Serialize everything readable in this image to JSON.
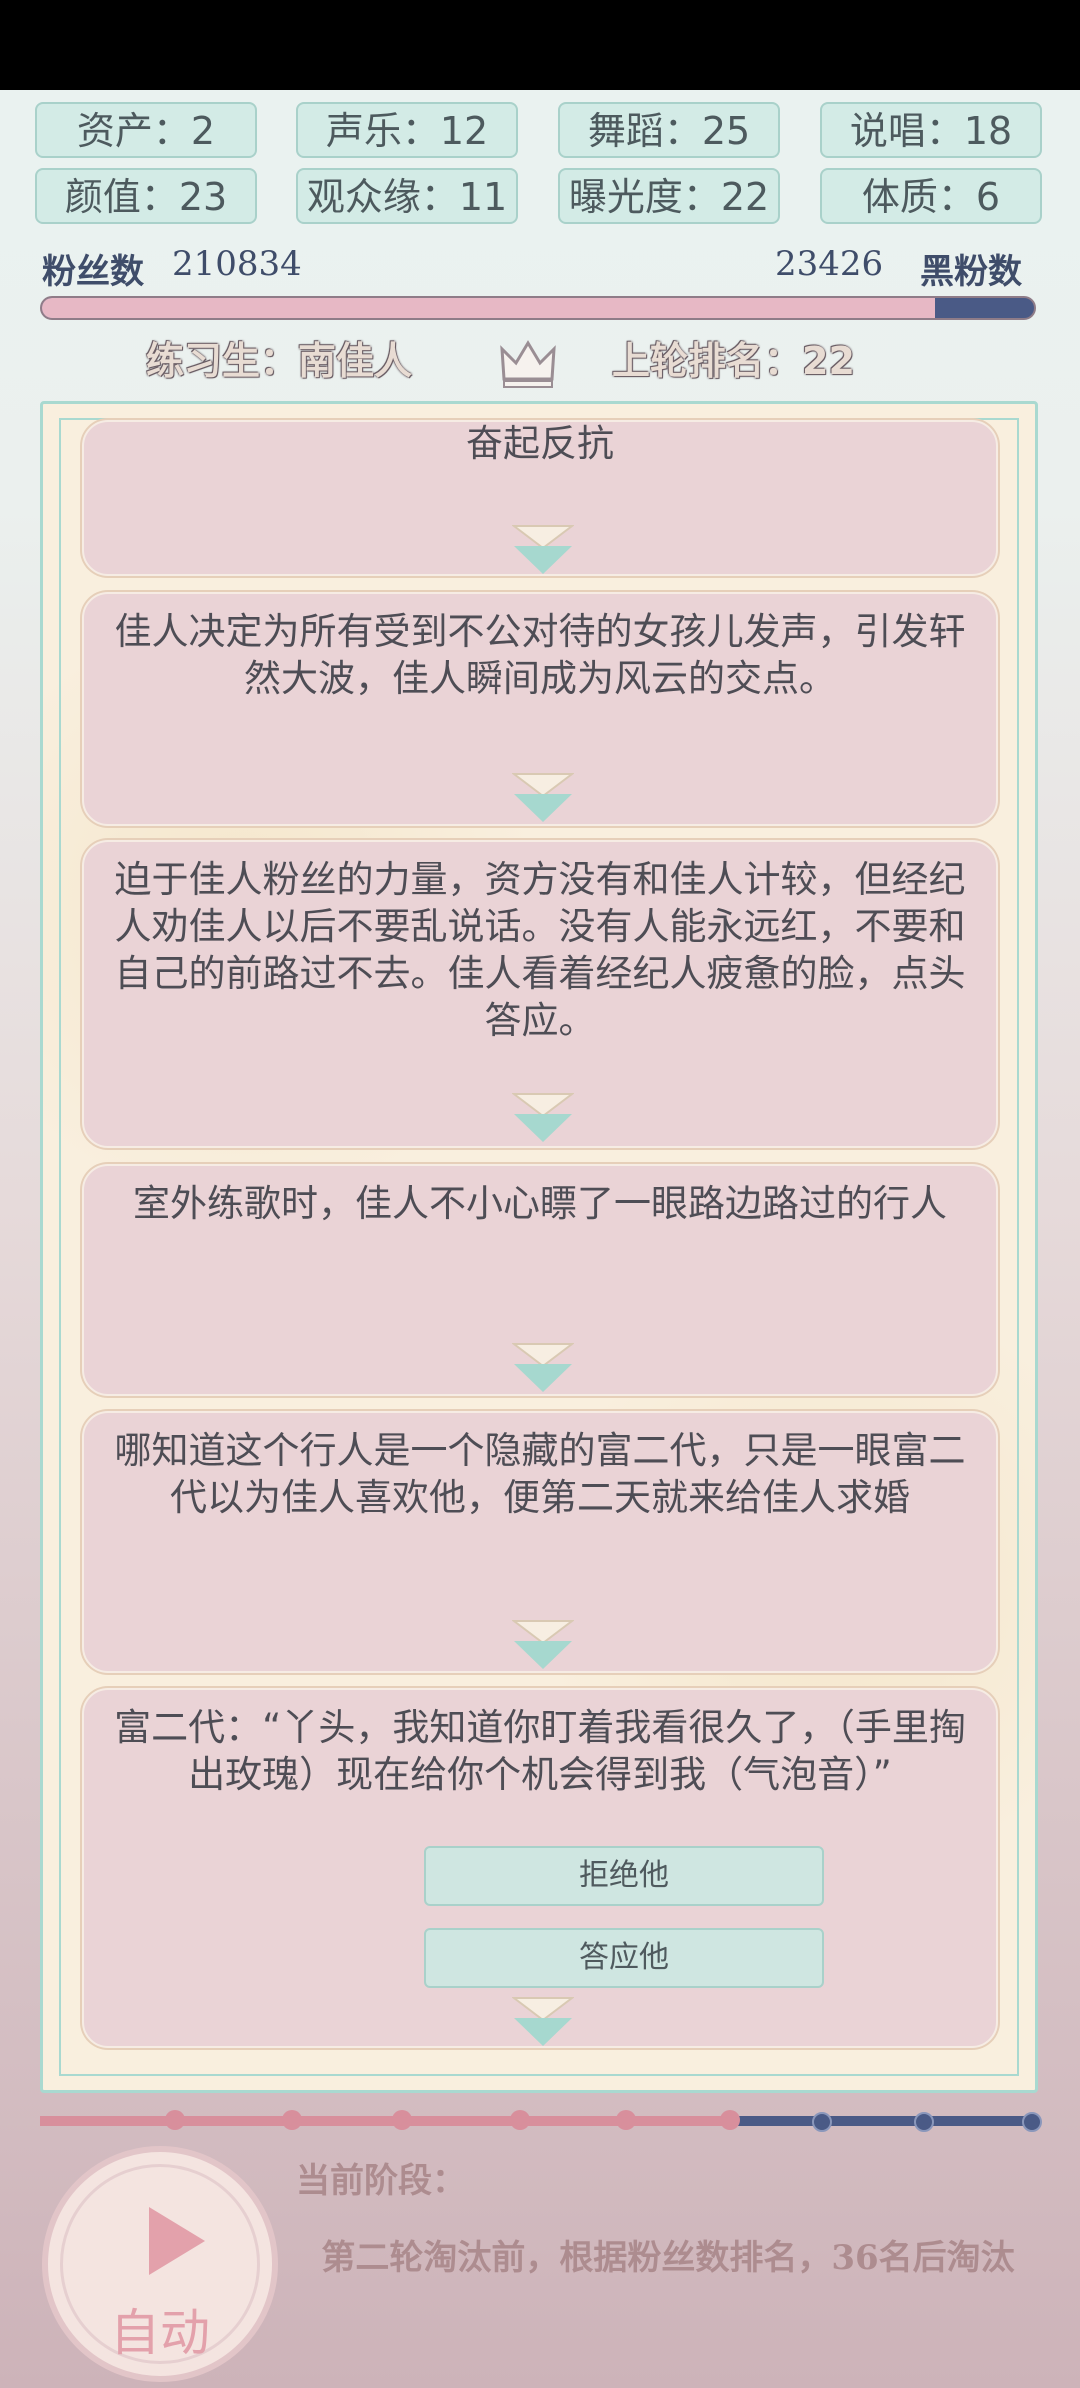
{
  "stats": {
    "assets": "资产：2",
    "vocal": "声乐：12",
    "dance": "舞蹈：25",
    "rap": "说唱：18",
    "looks": "颜值：23",
    "audience": "观众缘：11",
    "exposure": "曝光度：22",
    "physique": "体质：6"
  },
  "fans": {
    "label": "粉丝数",
    "count": "210834",
    "anti_count": "23426",
    "anti_label": "黑粉数",
    "fan_fraction": 0.9
  },
  "trainee": {
    "name_line": "练习生：南佳人",
    "rank_line": "上轮排名：22"
  },
  "story": {
    "cards": [
      "奋起反抗",
      "佳人决定为所有受到不公对待的女孩儿发声，引发轩然大波，佳人瞬间成为风云的交点。",
      "迫于佳人粉丝的力量，资方没有和佳人计较，但经纪人劝佳人以后不要乱说话。没有人能永远红，不要和自己的前路过不去。佳人看着经纪人疲惫的脸，点头答应。",
      "室外练歌时，佳人不小心瞟了一眼路边路过的行人",
      "哪知道这个行人是一个隐藏的富二代，只是一眼富二代以为佳人喜欢他，便第二天就来给佳人求婚",
      "富二代：“丫头，我知道你盯着我看很久了，（手里掏出玫瑰）现在给你个机会得到我（气泡音）”"
    ],
    "choices": [
      "拒绝他",
      "答应他"
    ]
  },
  "progress": {
    "completed_stages": 6,
    "total_stages": 9
  },
  "auto_button": {
    "label": "自动"
  },
  "stage": {
    "label": "当前阶段：",
    "description": "第二轮淘汰前，根据粉丝数排名，36名后淘汰"
  },
  "colors": {
    "pink": "#e7b8c5",
    "navy": "#4a5a86",
    "teal": "#a9d9d0",
    "card": "#ead3d6"
  }
}
